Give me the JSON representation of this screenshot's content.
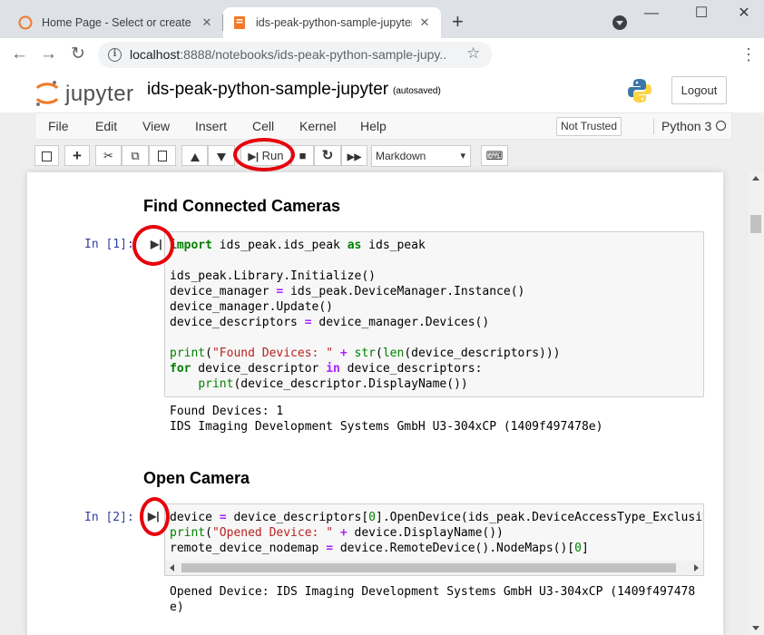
{
  "browser": {
    "tabs": [
      {
        "title": "Home Page - Select or create a n",
        "close": "✕"
      },
      {
        "title": "ids-peak-python-sample-jupyter",
        "close": "✕"
      }
    ],
    "new_tab": "+",
    "window_controls": {
      "minimize": "—",
      "maximize": "☐",
      "close": "✕"
    },
    "nav": {
      "back": "←",
      "forward": "→",
      "reload": "↻"
    },
    "url_host": "localhost",
    "url_rest": ":8888/notebooks/ids-peak-python-sample-jupy...",
    "info_icon": "i",
    "star_icon": "☆",
    "menu_icon": "⋮"
  },
  "jupyter": {
    "logo_text": "jupyter",
    "notebook_name": "ids-peak-python-sample-jupyter",
    "autosave": "(autosaved)",
    "logout_label": "Logout",
    "menu": [
      "File",
      "Edit",
      "View",
      "Insert",
      "Cell",
      "Kernel",
      "Help"
    ],
    "trust_label": "Not Trusted",
    "kernel_name": "Python 3",
    "toolbar": {
      "save": "💾",
      "add": "+",
      "cut": "✂",
      "copy": "⧉",
      "paste": "📋",
      "move_up": "🡑",
      "move_down": "🡓",
      "run_label": "Run",
      "run_icon": "⏭",
      "stop": "■",
      "restart": "↻",
      "fast_forward": "⏩",
      "cell_type": "Markdown",
      "cell_type_chevron": "▾",
      "command_palette": "⌨"
    }
  },
  "notebook": {
    "heading1": "Find Connected Cameras",
    "prompt1": "In [1]:",
    "output1": [
      "Found Devices: 1",
      "IDS Imaging Development Systems GmbH U3-304xCP (1409f497478e)"
    ],
    "heading2": "Open Camera",
    "prompt2": "In [2]:",
    "output2": [
      "Opened Device: IDS Imaging Development Systems GmbH U3-304xCP (1409f497478",
      "e)"
    ],
    "run_cell_glyph": "⏭"
  },
  "colors": {
    "highlight": "#e8000b",
    "prompt": "#303f9f",
    "keyword": "#008000",
    "string": "#ba2121"
  }
}
